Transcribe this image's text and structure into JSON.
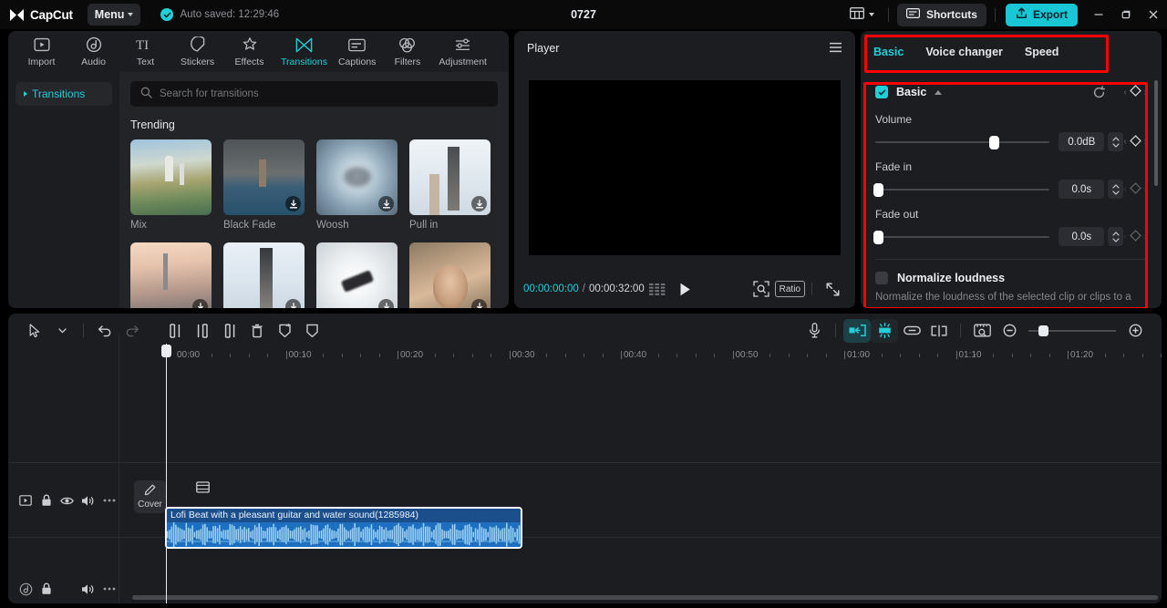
{
  "titlebar": {
    "app_name": "CapCut",
    "menu_label": "Menu",
    "autosave_text": "Auto saved: 12:29:46",
    "project_title": "0727",
    "shortcuts_label": "Shortcuts",
    "export_label": "Export",
    "accent_color": "#19c6d4"
  },
  "nav_tabs": [
    {
      "label": "Import",
      "icon": "import-icon",
      "active": false
    },
    {
      "label": "Audio",
      "icon": "audio-icon",
      "active": false
    },
    {
      "label": "Text",
      "icon": "text-icon",
      "active": false
    },
    {
      "label": "Stickers",
      "icon": "stickers-icon",
      "active": false
    },
    {
      "label": "Effects",
      "icon": "effects-icon",
      "active": false
    },
    {
      "label": "Transitions",
      "icon": "transitions-icon",
      "active": true
    },
    {
      "label": "Captions",
      "icon": "captions-icon",
      "active": false
    },
    {
      "label": "Filters",
      "icon": "filters-icon",
      "active": false
    },
    {
      "label": "Adjustment",
      "icon": "adjustment-icon",
      "active": false
    }
  ],
  "left_panel": {
    "sidebar_items": [
      {
        "label": "Transitions",
        "selected": true
      }
    ],
    "search_placeholder": "Search for transitions",
    "search_value": "",
    "section_title": "Trending",
    "transitions": [
      {
        "label": "Mix",
        "art": "t-mix",
        "downloadable": false
      },
      {
        "label": "Black Fade",
        "art": "t-blackfade",
        "downloadable": true
      },
      {
        "label": "Woosh",
        "art": "t-woosh",
        "downloadable": true
      },
      {
        "label": "Pull in",
        "art": "t-pullin",
        "downloadable": true
      },
      {
        "label": "",
        "art": "t-city2",
        "downloadable": true
      },
      {
        "label": "",
        "art": "t-tower2",
        "downloadable": true
      },
      {
        "label": "",
        "art": "t-lipstick",
        "downloadable": true
      },
      {
        "label": "",
        "art": "t-portrait",
        "downloadable": true
      }
    ]
  },
  "player": {
    "title": "Player",
    "current_time": "00:00:00:00",
    "time_separator": "/",
    "total_time": "00:00:32:00",
    "ratio_label": "Ratio"
  },
  "right_panel": {
    "tabs": [
      {
        "label": "Basic",
        "active": true
      },
      {
        "label": "Voice changer",
        "active": false
      },
      {
        "label": "Speed",
        "active": false
      }
    ],
    "section": {
      "title": "Basic",
      "enabled": true
    },
    "params": [
      {
        "label": "Volume",
        "value": "0.0dB",
        "slider_pct": 68
      },
      {
        "label": "Fade in",
        "value": "0.0s",
        "slider_pct": 0
      },
      {
        "label": "Fade out",
        "value": "0.0s",
        "slider_pct": 0
      }
    ],
    "normalize": {
      "label": "Normalize loudness",
      "checked": false,
      "description": "Normalize the loudness of the selected clip or clips to a"
    },
    "highlight_color": "#ff0000"
  },
  "timeline": {
    "toolbar_left": [
      {
        "icon": "select-cursor-icon",
        "state": "normal"
      },
      {
        "icon": "chevron-down-icon",
        "state": "normal"
      },
      {
        "icon": "undo-icon",
        "state": "normal"
      },
      {
        "icon": "redo-icon",
        "state": "dim"
      },
      {
        "icon": "split-icon",
        "state": "normal"
      },
      {
        "icon": "trim-left-icon",
        "state": "normal"
      },
      {
        "icon": "trim-right-icon",
        "state": "normal"
      },
      {
        "icon": "delete-icon",
        "state": "normal"
      },
      {
        "icon": "freeze-frame-icon",
        "state": "normal"
      },
      {
        "icon": "mirror-icon",
        "state": "normal"
      }
    ],
    "toolbar_right": [
      {
        "icon": "microphone-icon",
        "state": "normal"
      },
      {
        "icon": "snap-to-clip-icon",
        "state": "active"
      },
      {
        "icon": "auto-snap-icon",
        "state": "active"
      },
      {
        "icon": "link-icon",
        "state": "normal"
      },
      {
        "icon": "split-clip-icon",
        "state": "normal"
      },
      {
        "icon": "timeline-preview-icon",
        "state": "normal"
      },
      {
        "icon": "zoom-out-icon",
        "state": "normal"
      },
      {
        "icon": "zoom-in-icon",
        "state": "normal"
      }
    ],
    "zoom_pct": 12,
    "ruler_labels": [
      "00:00",
      "00:10",
      "00:20",
      "00:30",
      "00:40",
      "00:50",
      "01:00",
      "01:10",
      "01:20"
    ],
    "playhead_time": "00:00",
    "video_track": {
      "icons": [
        "video-track-icon",
        "lock-icon",
        "eye-icon",
        "volume-icon",
        "more-options-icon"
      ],
      "cover_label": "Cover"
    },
    "audio_track": {
      "icons": [
        "audio-track-icon",
        "lock-icon",
        "volume-icon",
        "more-options-icon"
      ],
      "clip_title": "Lofi Beat with a pleasant guitar and water sound(1285984)"
    }
  }
}
